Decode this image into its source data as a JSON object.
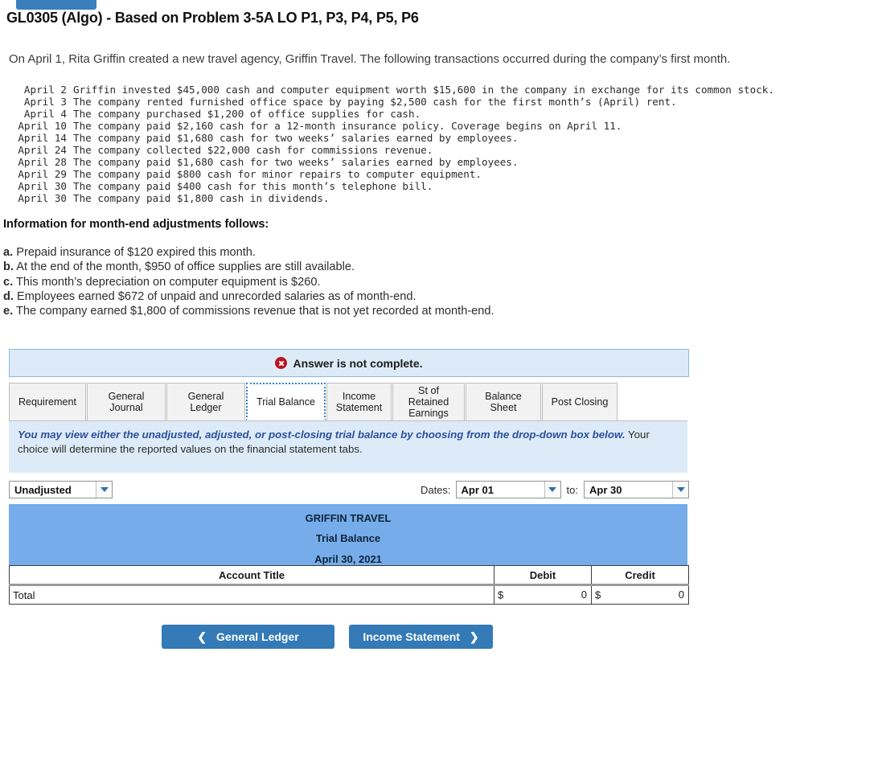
{
  "top_button": {
    "label": ""
  },
  "header": {
    "title": "GL0305 (Algo) - Based on Problem 3-5A LO P1, P3, P4, P5, P6",
    "intro": "On April 1, Rita Griffin created a new travel agency, Griffin Travel. The following transactions occurred during the company’s first month."
  },
  "transactions": [
    {
      "date": "April 2",
      "text": "Griffin invested $45,000 cash and computer equipment worth $15,600 in the company in exchange for its common stock."
    },
    {
      "date": "April 3",
      "text": "The company rented furnished office space by paying $2,500 cash for the first month’s (April) rent."
    },
    {
      "date": "April 4",
      "text": "The company purchased $1,200 of office supplies for cash."
    },
    {
      "date": "April 10",
      "text": "The company paid $2,160 cash for a 12-month insurance policy. Coverage begins on April 11."
    },
    {
      "date": "April 14",
      "text": "The company paid $1,680 cash for two weeks’ salaries earned by employees."
    },
    {
      "date": "April 24",
      "text": "The company collected $22,000 cash for commissions revenue."
    },
    {
      "date": "April 28",
      "text": "The company paid $1,680 cash for two weeks’ salaries earned by employees."
    },
    {
      "date": "April 29",
      "text": "The company paid $800 cash for minor repairs to computer equipment."
    },
    {
      "date": "April 30",
      "text": "The company paid $400 cash for this month’s telephone bill."
    },
    {
      "date": "April 30",
      "text": "The company paid $1,800 cash in dividends."
    }
  ],
  "adjustments": {
    "heading": "Information for month-end adjustments follows:",
    "items": [
      {
        "letter": "a.",
        "text": "Prepaid insurance of $120 expired this month."
      },
      {
        "letter": "b.",
        "text": "At the end of the month, $950 of office supplies are still available."
      },
      {
        "letter": "c.",
        "text": "This month’s depreciation on computer equipment is $260."
      },
      {
        "letter": "d.",
        "text": "Employees earned $672 of unpaid and unrecorded salaries as of month-end."
      },
      {
        "letter": "e.",
        "text": "The company earned $1,800 of commissions revenue that is not yet recorded at month-end."
      }
    ]
  },
  "alert": {
    "message": "Answer is not complete.",
    "icon": "error-circle-x-icon",
    "bg_color": "#dcebf7",
    "border_color": "#8fb8da",
    "icon_color": "#bd1220"
  },
  "tabs": [
    {
      "label": "Requirement",
      "active": false
    },
    {
      "label": "General Journal",
      "active": false
    },
    {
      "label": "General Ledger",
      "active": false
    },
    {
      "label": "Trial Balance",
      "active": true
    },
    {
      "label": "Income Statement",
      "active": false
    },
    {
      "label": "St of Retained Earnings",
      "active": false
    },
    {
      "label": "Balance Sheet",
      "active": false
    },
    {
      "label": "Post Closing",
      "active": false
    }
  ],
  "info_panel": {
    "emphasis": "You may view either the unadjusted, adjusted, or post-closing trial balance by choosing from the drop-down box below.",
    "rest": "Your choice will determine the reported values on the financial statement tabs."
  },
  "controls": {
    "period_value": "Unadjusted",
    "dates_label": "Dates:",
    "date_from": "Apr 01",
    "to_label": "to:",
    "date_to": "Apr 30"
  },
  "statement": {
    "company": "GRIFFIN TRAVEL",
    "title": "Trial Balance",
    "date": "April 30, 2021",
    "header_bg": "#76ace9"
  },
  "table": {
    "columns": [
      "Account Title",
      "Debit",
      "Credit"
    ],
    "rows": [
      {
        "account": "Total",
        "debit_symbol": "$",
        "debit": "0",
        "credit_symbol": "$",
        "credit": "0"
      }
    ]
  },
  "nav": {
    "prev_label": "General Ledger",
    "prev_icon": "chevron-left-icon",
    "next_label": "Income Statement",
    "next_icon": "chevron-right-icon",
    "button_color": "#337ab7"
  }
}
